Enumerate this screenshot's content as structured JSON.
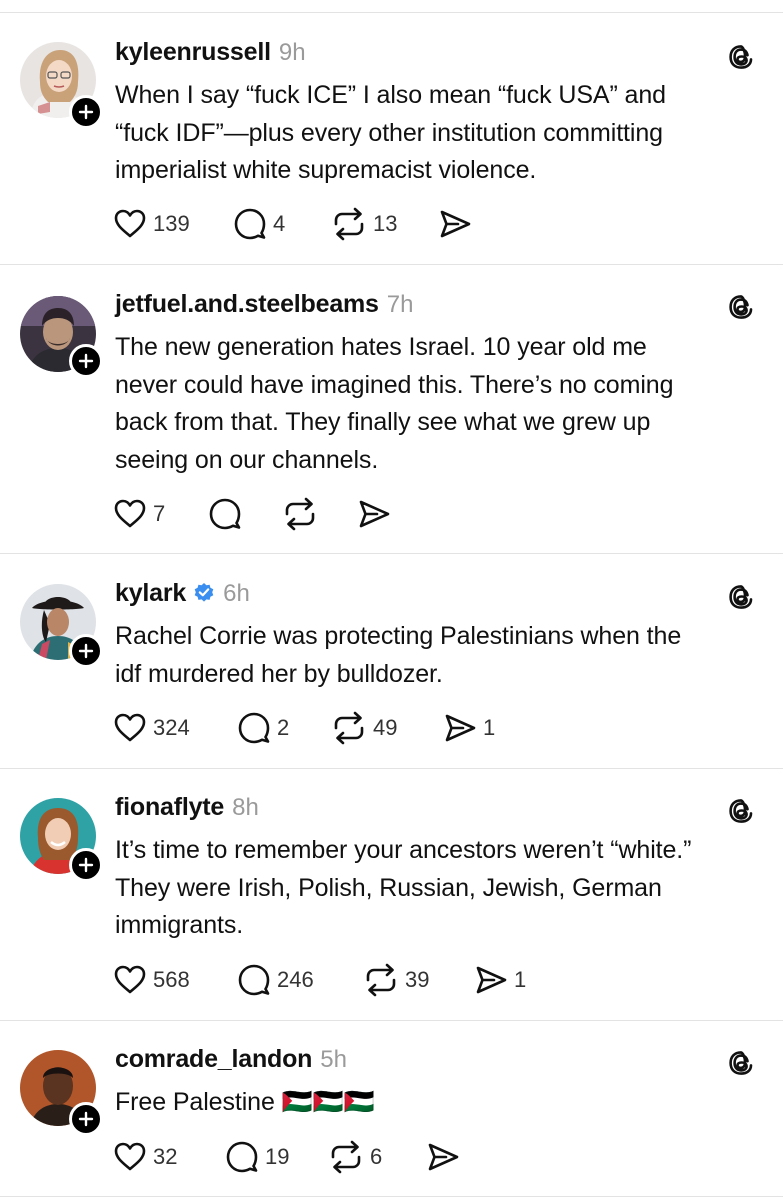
{
  "posts": [
    {
      "username": "kyleenrussell",
      "time": "9h",
      "verified": false,
      "lines": [
        "When I say “fuck ICE” I also mean “fuck USA” and",
        "“fuck IDF”—plus every other institution committing",
        "imperialist white supremacist violence."
      ],
      "likes": "139",
      "replies": "4",
      "reposts": "13",
      "shares": ""
    },
    {
      "username": "jetfuel.and.steelbeams",
      "time": "7h",
      "verified": false,
      "lines": [
        "The new generation hates Israel. 10 year old me",
        "never could have imagined this. There’s no coming",
        "back from that. They finally see what we grew up",
        "seeing on our channels."
      ],
      "likes": "7",
      "replies": "",
      "reposts": "",
      "shares": ""
    },
    {
      "username": "kylark",
      "time": "6h",
      "verified": true,
      "lines": [
        "Rachel Corrie was protecting Palestinians when the",
        "idf murdered her by bulldozer."
      ],
      "likes": "324",
      "replies": "2",
      "reposts": "49",
      "shares": "1"
    },
    {
      "username": "fionaflyte",
      "time": "8h",
      "verified": false,
      "lines": [
        "It’s time to remember your ancestors weren’t “white.”",
        "They were Irish, Polish, Russian, Jewish, German",
        "immigrants."
      ],
      "likes": "568",
      "replies": "246",
      "reposts": "39",
      "shares": "1"
    },
    {
      "username": "comrade_landon",
      "time": "5h",
      "verified": false,
      "lines": [
        "Free Palestine 🇵🇸🇵🇸🇵🇸"
      ],
      "likes": "32",
      "replies": "19",
      "reposts": "6",
      "shares": ""
    }
  ],
  "icons": {
    "like": "heart-icon",
    "reply": "comment-icon",
    "repost": "repost-icon",
    "share": "send-icon",
    "app": "threads-icon",
    "follow": "plus-icon",
    "verified": "verified-badge-icon"
  },
  "colors": {
    "verified": "#3a8ef0",
    "text": "#111111",
    "meta": "#9a9a9a",
    "separator": "#e3e3e3"
  }
}
